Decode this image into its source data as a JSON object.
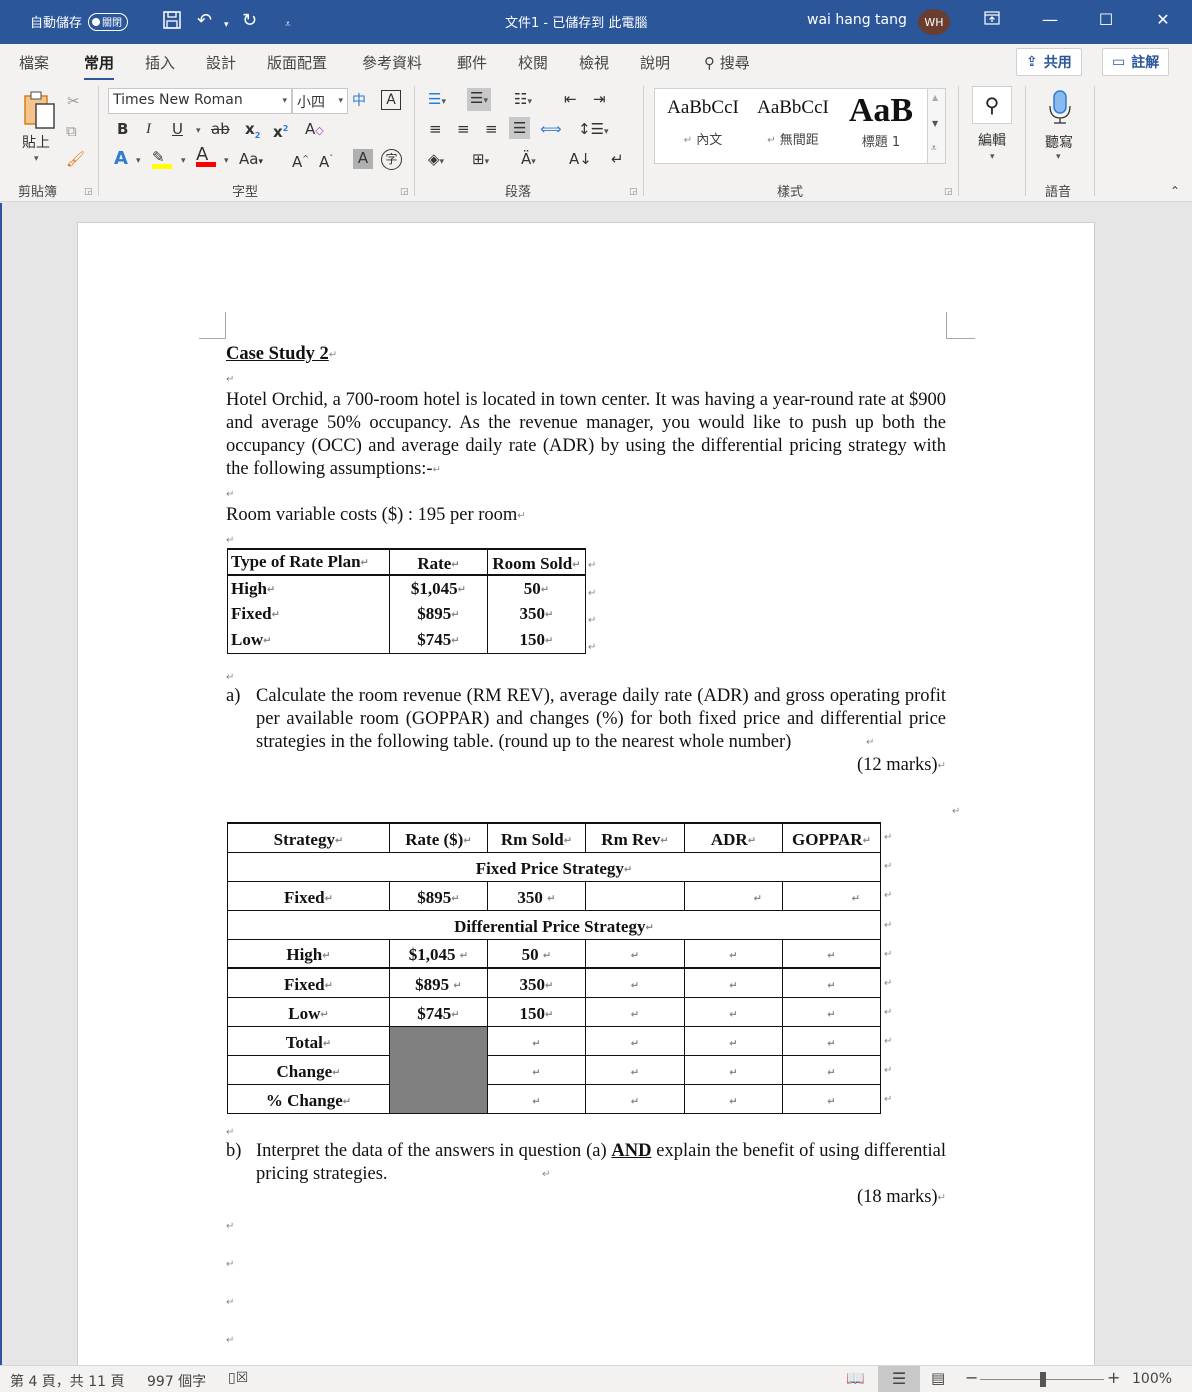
{
  "titlebar": {
    "autosave_label": "自動儲存",
    "autosave_state": "關閉",
    "doc_title": "文件1 - 已儲存到 此電腦",
    "user_name": "wai hang tang",
    "user_initials": "WH"
  },
  "tabs": [
    {
      "label": "檔案"
    },
    {
      "label": "常用",
      "active": true
    },
    {
      "label": "插入"
    },
    {
      "label": "設計"
    },
    {
      "label": "版面配置"
    },
    {
      "label": "參考資料"
    },
    {
      "label": "郵件"
    },
    {
      "label": "校閱"
    },
    {
      "label": "檢視"
    },
    {
      "label": "說明"
    },
    {
      "label": "搜尋"
    }
  ],
  "share_label": "共用",
  "comments_label": "註解",
  "ribbon": {
    "clipboard": {
      "paste_label": "貼上",
      "group_label": "剪貼簿"
    },
    "font": {
      "font_name": "Times New Roman",
      "font_size": "小四",
      "group_label": "字型",
      "highlight_color": "#ffff00",
      "font_color": "#ff0000"
    },
    "paragraph": {
      "group_label": "段落"
    },
    "styles": {
      "group_label": "樣式",
      "items": [
        {
          "sample": "AaBbCcI",
          "name": "內文"
        },
        {
          "sample": "AaBbCcI",
          "name": "無間距"
        },
        {
          "sample": "AaB",
          "name": "標題 1"
        }
      ]
    },
    "editing": {
      "label": "編輯"
    },
    "voice": {
      "label": "聽寫",
      "group_label": "語音"
    }
  },
  "document": {
    "heading": "Case Study 2",
    "intro": "Hotel Orchid, a 700-room hotel is located in town center. It was having a year-round rate at $900 and average 50% occupancy. As the revenue manager, you would like to push up both the occupancy (OCC) and average daily rate (ADR) by using the differential pricing strategy with the following assumptions:-",
    "variable_costs": "Room variable costs ($) : 195 per room",
    "rate_table": {
      "headers": [
        "Type of Rate Plan",
        "Rate",
        "Room Sold"
      ],
      "rows": [
        [
          "High",
          "$1,045",
          "50"
        ],
        [
          "Fixed",
          "$895",
          "350"
        ],
        [
          "Low",
          "$745",
          "150"
        ]
      ]
    },
    "question_a": {
      "marker": "a)",
      "text": "Calculate the room revenue (RM REV), average daily rate (ADR) and gross operating profit per available room (GOPPAR) and changes (%) for both fixed price and differential price strategies in the following table. (round up to the nearest whole number)",
      "marks": "(12 marks)"
    },
    "strategy_table": {
      "headers": [
        "Strategy",
        "Rate ($)",
        "Rm Sold",
        "Rm Rev",
        "ADR",
        "GOPPAR"
      ],
      "fixed_section": "Fixed Price Strategy",
      "fixed_row": [
        "Fixed",
        "$895",
        "350",
        "",
        "",
        ""
      ],
      "diff_section": "Differential Price Strategy",
      "diff_rows": [
        [
          "High",
          "$1,045",
          "50",
          "",
          "",
          ""
        ],
        [
          "Fixed",
          "$895",
          "350",
          "",
          "",
          ""
        ],
        [
          "Low",
          "$745",
          "150",
          "",
          "",
          ""
        ]
      ],
      "summary_rows": [
        [
          "Total",
          "",
          "",
          "",
          ""
        ],
        [
          "Change",
          "",
          "",
          "",
          ""
        ],
        [
          "% Change",
          "",
          "",
          "",
          ""
        ]
      ]
    },
    "question_b": {
      "marker": "b)",
      "text_before": "Interpret the data of the answers in question (a) ",
      "emphasis": "AND",
      "text_after": " explain the benefit of using differential pricing strategies.",
      "marks": "(18 marks)"
    }
  },
  "statusbar": {
    "page_info": "第 4 頁，共 11 頁",
    "word_count": "997 個字",
    "zoom": "100%"
  }
}
